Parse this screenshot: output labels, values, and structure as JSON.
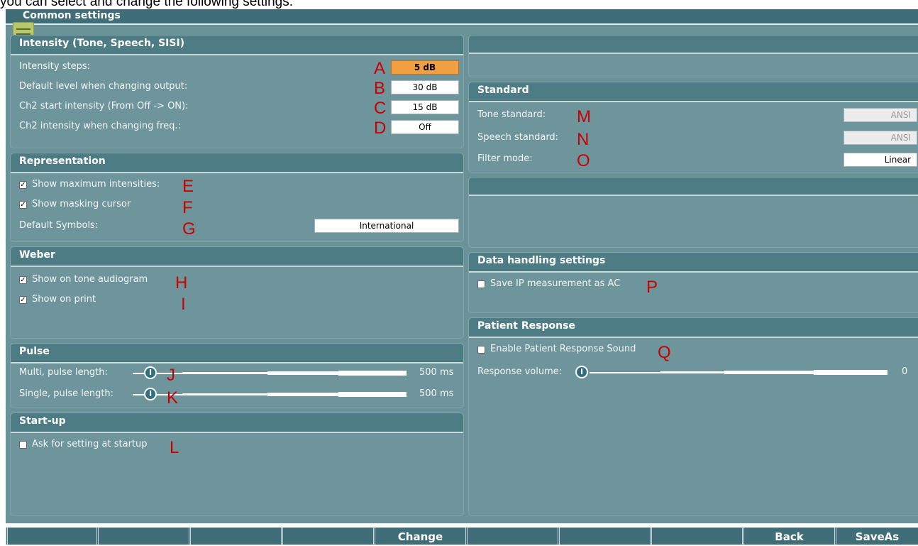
{
  "caption": "you can select and change the following settings:",
  "app_title": "Common settings",
  "intensity": {
    "title": "Intensity (Tone, Speech, SISI)",
    "rows": [
      {
        "label": "Intensity steps:",
        "letter": "A",
        "value": "5 dB"
      },
      {
        "label": "Default level when changing output:",
        "letter": "B",
        "value": "30 dB"
      },
      {
        "label": "Ch2 start intensity (From Off -> ON):",
        "letter": "C",
        "value": "15 dB"
      },
      {
        "label": "Ch2 intensity when changing freq.:",
        "letter": "D",
        "value": "Off"
      }
    ]
  },
  "representation": {
    "title": "Representation",
    "show_max_label": "Show maximum intensities:",
    "show_max_letter": "E",
    "show_max_checked": true,
    "show_mask_label": "Show masking cursor",
    "show_mask_letter": "F",
    "show_mask_checked": true,
    "symbols_label": "Default Symbols:",
    "symbols_letter": "G",
    "symbols_value": "International"
  },
  "weber": {
    "title": "Weber",
    "tone_label": "Show on tone audiogram",
    "tone_letter": "H",
    "tone_checked": true,
    "print_label": "Show on print",
    "print_letter": "I",
    "print_checked": true
  },
  "pulse": {
    "title": "Pulse",
    "multi_label": "Multi, pulse length:",
    "multi_letter": "J",
    "multi_value": "500 ms",
    "single_label": "Single, pulse length:",
    "single_letter": "K",
    "single_value": "500 ms"
  },
  "startup": {
    "title": "Start-up",
    "ask_label": "Ask for setting at startup",
    "ask_letter": "L",
    "ask_checked": false
  },
  "standard": {
    "title": "Standard",
    "tone_label": "Tone standard:",
    "tone_letter": "M",
    "tone_value": "ANSI",
    "speech_label": "Speech standard:",
    "speech_letter": "N",
    "speech_value": "ANSI",
    "filter_label": "Filter mode:",
    "filter_letter": "O",
    "filter_value": "Linear"
  },
  "data_handling": {
    "title": "Data handling settings",
    "save_ip_label": "Save IP measurement as AC",
    "save_ip_letter": "P",
    "save_ip_checked": false
  },
  "patient_response": {
    "title": "Patient Response",
    "enable_label": "Enable Patient Response Sound",
    "enable_letter": "Q",
    "enable_checked": false,
    "volume_label": "Response volume:",
    "volume_value": "0"
  },
  "function_keys": [
    "",
    "",
    "",
    "",
    "Change",
    "",
    "",
    "",
    "Back",
    "SaveAs"
  ],
  "colors": {
    "accent": "#f0a040",
    "panel": "#6e959b",
    "header": "#4e7c85",
    "letters": "#cc0000"
  }
}
